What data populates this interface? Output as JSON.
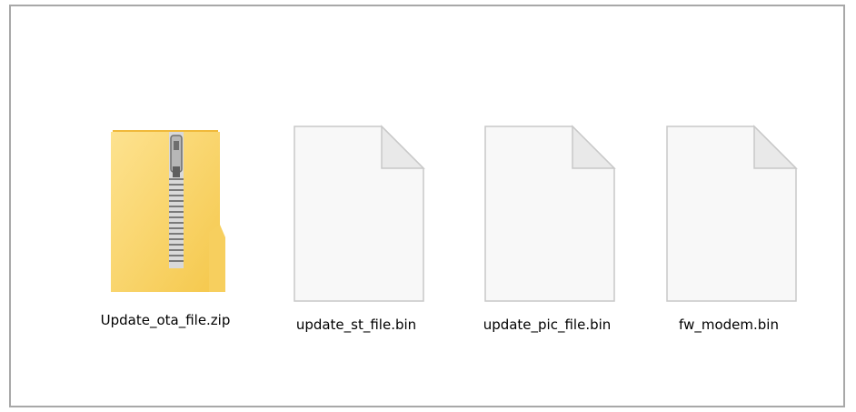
{
  "files": [
    {
      "name": "Update_ota_file.zip",
      "icon": "zip-folder-icon"
    },
    {
      "name": "update_st_file.bin",
      "icon": "blank-file-icon"
    },
    {
      "name": "update_pic_file.bin",
      "icon": "blank-file-icon"
    },
    {
      "name": "fw_modem.bin",
      "icon": "blank-file-icon"
    }
  ],
  "colors": {
    "folder_yellow": "#f5c84c",
    "folder_light": "#fcdb7f",
    "zipper_gray": "#8a8a8a",
    "page_white": "#f7f7f7",
    "page_border": "#c8c8c8",
    "frame_border": "#a8a8a8"
  }
}
